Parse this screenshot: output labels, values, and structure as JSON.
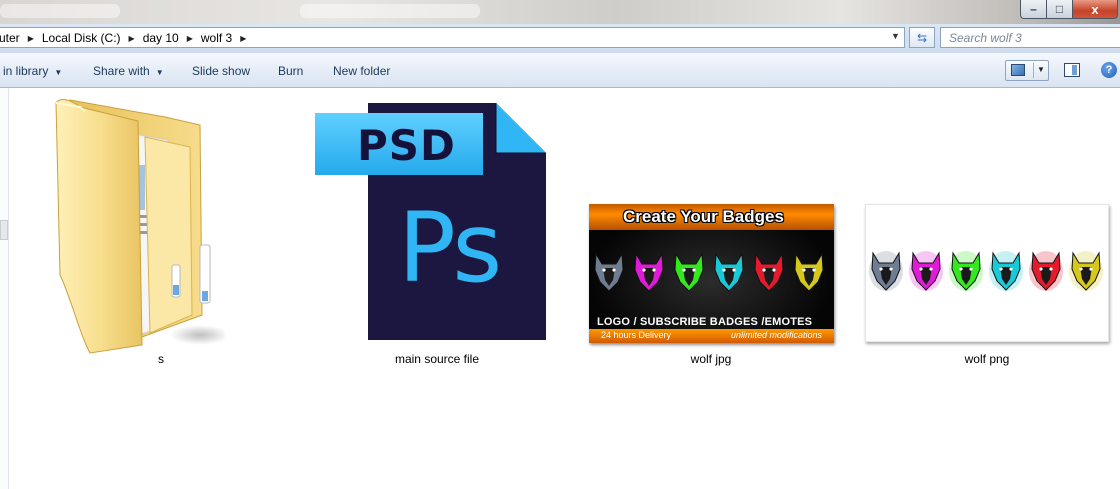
{
  "window": {
    "controls": {
      "minimize": "–",
      "maximize": "□",
      "close": "x"
    }
  },
  "address_bar": {
    "crumbs": [
      "uter",
      "Local Disk (C:)",
      "day 10",
      "wolf 3"
    ],
    "search_placeholder": "Search wolf 3"
  },
  "command_bar": {
    "items": [
      {
        "label": "in library",
        "has_dropdown": true
      },
      {
        "label": "Share with",
        "has_dropdown": true
      },
      {
        "label": "Slide show",
        "has_dropdown": false
      },
      {
        "label": "Burn",
        "has_dropdown": false
      },
      {
        "label": "New folder",
        "has_dropdown": false
      }
    ],
    "help_label": "?"
  },
  "files": [
    {
      "name": "s",
      "type": "folder"
    },
    {
      "name": "main source file",
      "type": "psd",
      "icon_text": "PSD",
      "icon_mark": "Ps"
    },
    {
      "name": "wolf jpg",
      "type": "jpg",
      "thumb": {
        "header": "Create Your Badges",
        "footer": "LOGO / SUBSCRIBE BADGES /EMOTES",
        "left_note": "24 hours Delivery",
        "right_note": "unlimited modifications"
      }
    },
    {
      "name": "wolf png",
      "type": "png"
    }
  ],
  "colors": {
    "wolves": [
      "#6e7d91",
      "#e01ad8",
      "#33e81f",
      "#18c9d8",
      "#e31b2d",
      "#d6c81a"
    ],
    "psd_accent": "#31b6f5",
    "psd_body": "#1b1740"
  }
}
